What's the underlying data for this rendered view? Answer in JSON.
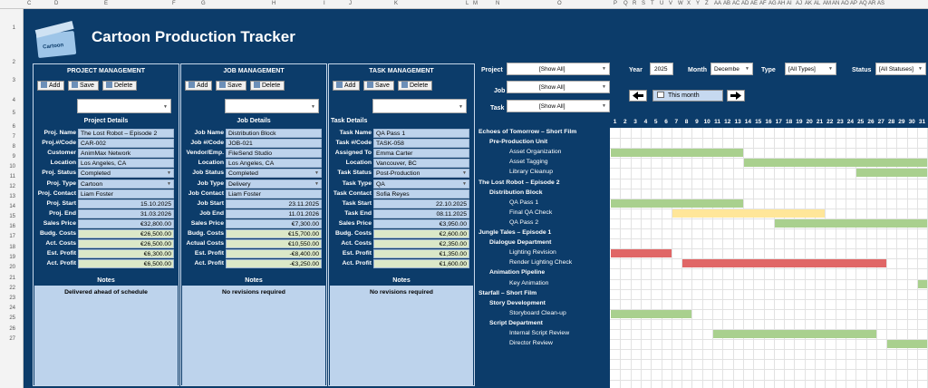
{
  "app": {
    "title": "Cartoon Production Tracker",
    "logo_text": "Cartoon"
  },
  "spreadsheet": {
    "columns": [
      "C",
      "D",
      "E",
      "F",
      "G",
      "H",
      "I",
      "J",
      "K",
      "L",
      "M",
      "N",
      "O",
      "P",
      "Q",
      "R",
      "S",
      "T",
      "U",
      "V",
      "W",
      "X",
      "Y",
      "Z",
      "AA",
      "AB",
      "AC",
      "AD",
      "AE",
      "AF",
      "AG",
      "AH",
      "AI",
      "AJ",
      "AK",
      "AL",
      "AM",
      "AN",
      "AO",
      "AP",
      "AQ",
      "AR",
      "AS"
    ],
    "rows": [
      "1",
      "2",
      "3",
      "4",
      "5",
      "6",
      "7",
      "8",
      "9",
      "10",
      "11",
      "12",
      "13",
      "14",
      "15",
      "16",
      "17",
      "18",
      "19",
      "20",
      "21",
      "22",
      "23",
      "24",
      "25",
      "26",
      "27"
    ]
  },
  "project_panel": {
    "title": "PROJECT MANAGEMENT",
    "buttons": {
      "add": "Add",
      "save": "Save",
      "delete": "Delete"
    },
    "section": "Project Details",
    "fields": [
      {
        "label": "Proj. Name",
        "value": "The Lost Robot – Episode 2"
      },
      {
        "label": "Proj.#/Code",
        "value": "CAR-002"
      },
      {
        "label": "Customer",
        "value": "AnimMax Network"
      },
      {
        "label": "Location",
        "value": "Los Angeles, CA"
      },
      {
        "label": "Proj. Status",
        "value": "Completed"
      },
      {
        "label": "Proj. Type",
        "value": "Cartoon"
      },
      {
        "label": "Proj. Contact",
        "value": "Liam Foster"
      },
      {
        "label": "Proj. Start",
        "value": "15.10.2025"
      },
      {
        "label": "Proj. End",
        "value": "31.03.2026"
      },
      {
        "label": "Sales Price",
        "value": "€32,800.00"
      },
      {
        "label": "Budg. Costs",
        "value": "€26,500.00"
      },
      {
        "label": "Act. Costs",
        "value": "€26,500.00"
      },
      {
        "label": "Est. Profit",
        "value": "€6,300.00"
      },
      {
        "label": "Act. Profit",
        "value": "€6,500.00"
      }
    ],
    "notes_label": "Notes",
    "notes": "Delivered ahead of schedule"
  },
  "job_panel": {
    "title": "JOB MANAGEMENT",
    "buttons": {
      "add": "Add",
      "save": "Save",
      "delete": "Delete"
    },
    "section": "Job Details",
    "fields": [
      {
        "label": "Job Name",
        "value": "Distribution Block"
      },
      {
        "label": "Job #/Code",
        "value": "JOB-021"
      },
      {
        "label": "Vendor/Emp.",
        "value": "FileSend Studio"
      },
      {
        "label": "Location",
        "value": "Los Angeles, CA"
      },
      {
        "label": "Job Status",
        "value": "Completed"
      },
      {
        "label": "Job Type",
        "value": "Delivery"
      },
      {
        "label": "Job Contact",
        "value": "Liam Foster"
      },
      {
        "label": "Job Start",
        "value": "23.11.2025"
      },
      {
        "label": "Job End",
        "value": "11.01.2026"
      },
      {
        "label": "Sales Price",
        "value": "€7,300.00"
      },
      {
        "label": "Budg. Costs",
        "value": "€15,700.00"
      },
      {
        "label": "Actual Costs",
        "value": "€10,550.00"
      },
      {
        "label": "Est. Profit",
        "value": "-€8,400.00"
      },
      {
        "label": "Act. Profit",
        "value": "-€3,250.00"
      }
    ],
    "notes_label": "Notes",
    "notes": "No revisions required"
  },
  "task_panel": {
    "title": "TASK MANAGEMENT",
    "buttons": {
      "add": "Add",
      "save": "Save",
      "delete": "Delete"
    },
    "section": "Task Details",
    "fields": [
      {
        "label": "Task Name",
        "value": "QA Pass 1"
      },
      {
        "label": "Task #/Code",
        "value": "TASK-058"
      },
      {
        "label": "Assigned To",
        "value": "Emma Carter"
      },
      {
        "label": "Location",
        "value": "Vancouver, BC"
      },
      {
        "label": "Task Status",
        "value": "Post-Production"
      },
      {
        "label": "Task Type",
        "value": "QA"
      },
      {
        "label": "Task Contact",
        "value": "Sofia Reyes"
      },
      {
        "label": "Task Start",
        "value": "22.10.2025"
      },
      {
        "label": "Task End",
        "value": "08.11.2025"
      },
      {
        "label": "Sales Price",
        "value": "€3,950.00"
      },
      {
        "label": "Budg. Costs",
        "value": "€2,600.00"
      },
      {
        "label": "Act. Costs",
        "value": "€2,350.00"
      },
      {
        "label": "Est. Profit",
        "value": "€1,350.00"
      },
      {
        "label": "Act. Profit",
        "value": "€1,600.00"
      }
    ],
    "notes_label": "Notes",
    "notes": "No revisions required"
  },
  "filters": {
    "project_label": "Project",
    "project_value": "[Show All]",
    "job_label": "Job",
    "job_value": "[Show All]",
    "task_label": "Task",
    "task_value": "[Show All]",
    "year_label": "Year",
    "year_value": "2025",
    "month_label": "Month",
    "month_value": "Decembe",
    "type_label": "Type",
    "type_value": "[All Types]",
    "status_label": "Status",
    "status_value": "[All Statuses]",
    "this_month": "This month"
  },
  "days": [
    "1",
    "2",
    "3",
    "4",
    "5",
    "6",
    "7",
    "8",
    "9",
    "10",
    "11",
    "12",
    "13",
    "14",
    "15",
    "16",
    "17",
    "18",
    "19",
    "20",
    "21",
    "22",
    "23",
    "24",
    "25",
    "26",
    "27",
    "28",
    "29",
    "30",
    "31"
  ],
  "gantt": [
    {
      "name": "Echoes of Tomorrow – Short Film",
      "level": 0,
      "bars": []
    },
    {
      "name": "Pre-Production Unit",
      "level": 1,
      "bars": []
    },
    {
      "name": "Asset Organization",
      "level": 2,
      "bars": [
        {
          "start": 1,
          "end": 13,
          "color": "#a9d08e"
        }
      ]
    },
    {
      "name": "Asset Tagging",
      "level": 2,
      "bars": [
        {
          "start": 14,
          "end": 31,
          "color": "#a9d08e"
        }
      ]
    },
    {
      "name": "Library Cleanup",
      "level": 2,
      "bars": [
        {
          "start": 25,
          "end": 31,
          "color": "#a9d08e"
        }
      ]
    },
    {
      "name": "The Lost Robot – Episode 2",
      "level": 0,
      "bars": []
    },
    {
      "name": "Distribution Block",
      "level": 1,
      "bars": []
    },
    {
      "name": "QA Pass 1",
      "level": 2,
      "bars": [
        {
          "start": 1,
          "end": 13,
          "color": "#a9d08e"
        }
      ]
    },
    {
      "name": "Final QA Check",
      "level": 2,
      "bars": [
        {
          "start": 7,
          "end": 21,
          "color": "#ffe699"
        }
      ]
    },
    {
      "name": "QA Pass 2",
      "level": 2,
      "bars": [
        {
          "start": 17,
          "end": 31,
          "color": "#a9d08e"
        }
      ]
    },
    {
      "name": "Jungle Tales – Episode 1",
      "level": 0,
      "bars": []
    },
    {
      "name": "Dialogue Department",
      "level": 1,
      "bars": []
    },
    {
      "name": "Lighting Revision",
      "level": 2,
      "bars": [
        {
          "start": 1,
          "end": 6,
          "color": "#e06666"
        }
      ]
    },
    {
      "name": "Render Lighting Check",
      "level": 2,
      "bars": [
        {
          "start": 8,
          "end": 27,
          "color": "#e06666"
        }
      ]
    },
    {
      "name": "Animation Pipeline",
      "level": 1,
      "bars": []
    },
    {
      "name": "Key Animation",
      "level": 2,
      "bars": [
        {
          "start": 31,
          "end": 31,
          "color": "#a9d08e"
        }
      ]
    },
    {
      "name": "Starfall – Short Film",
      "level": 0,
      "bars": []
    },
    {
      "name": "Story Development",
      "level": 1,
      "bars": []
    },
    {
      "name": "Storyboard Clean-up",
      "level": 2,
      "bars": [
        {
          "start": 1,
          "end": 8,
          "color": "#a9d08e"
        }
      ]
    },
    {
      "name": "Script Department",
      "level": 1,
      "bars": []
    },
    {
      "name": "Internal Script Review",
      "level": 2,
      "bars": [
        {
          "start": 11,
          "end": 26,
          "color": "#a9d08e"
        }
      ]
    },
    {
      "name": "Director Review",
      "level": 2,
      "bars": [
        {
          "start": 28,
          "end": 31,
          "color": "#a9d08e"
        }
      ]
    }
  ]
}
